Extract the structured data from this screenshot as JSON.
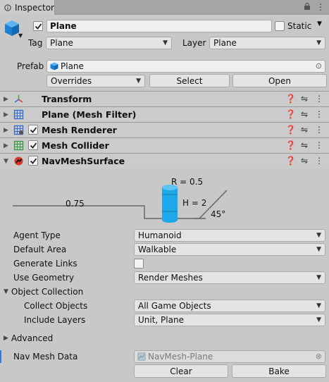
{
  "window": {
    "tab_title": "Inspector"
  },
  "object": {
    "name": "Plane",
    "active": true,
    "static_label": "Static",
    "tag_label": "Tag",
    "tag_value": "Plane",
    "layer_label": "Layer",
    "layer_value": "Plane",
    "prefab_label": "Prefab",
    "prefab_value": "Plane",
    "overrides_label": "Overrides",
    "select_label": "Select",
    "open_label": "Open"
  },
  "components": [
    {
      "title": "Transform",
      "has_checkbox": false
    },
    {
      "title": "Plane (Mesh Filter)",
      "has_checkbox": false
    },
    {
      "title": "Mesh Renderer",
      "has_checkbox": true
    },
    {
      "title": "Mesh Collider",
      "has_checkbox": true
    },
    {
      "title": "NavMeshSurface",
      "has_checkbox": true
    }
  ],
  "diagram": {
    "radius_label": "R = 0.5",
    "height_label": "H = 2",
    "step_label": "0.75",
    "slope_label": "45°"
  },
  "navmesh": {
    "agent_type_label": "Agent Type",
    "agent_type_value": "Humanoid",
    "default_area_label": "Default Area",
    "default_area_value": "Walkable",
    "generate_links_label": "Generate Links",
    "use_geometry_label": "Use Geometry",
    "use_geometry_value": "Render Meshes",
    "object_collection_label": "Object Collection",
    "collect_objects_label": "Collect Objects",
    "collect_objects_value": "All Game Objects",
    "include_layers_label": "Include Layers",
    "include_layers_value": "Unit, Plane",
    "advanced_label": "Advanced",
    "nav_mesh_data_label": "Nav Mesh Data",
    "nav_mesh_data_value": "NavMesh-Plane",
    "clear_label": "Clear",
    "bake_label": "Bake"
  },
  "colors": {
    "agent_cylinder": "#1ea8e8",
    "selection_bar": "#3a7bd5"
  }
}
